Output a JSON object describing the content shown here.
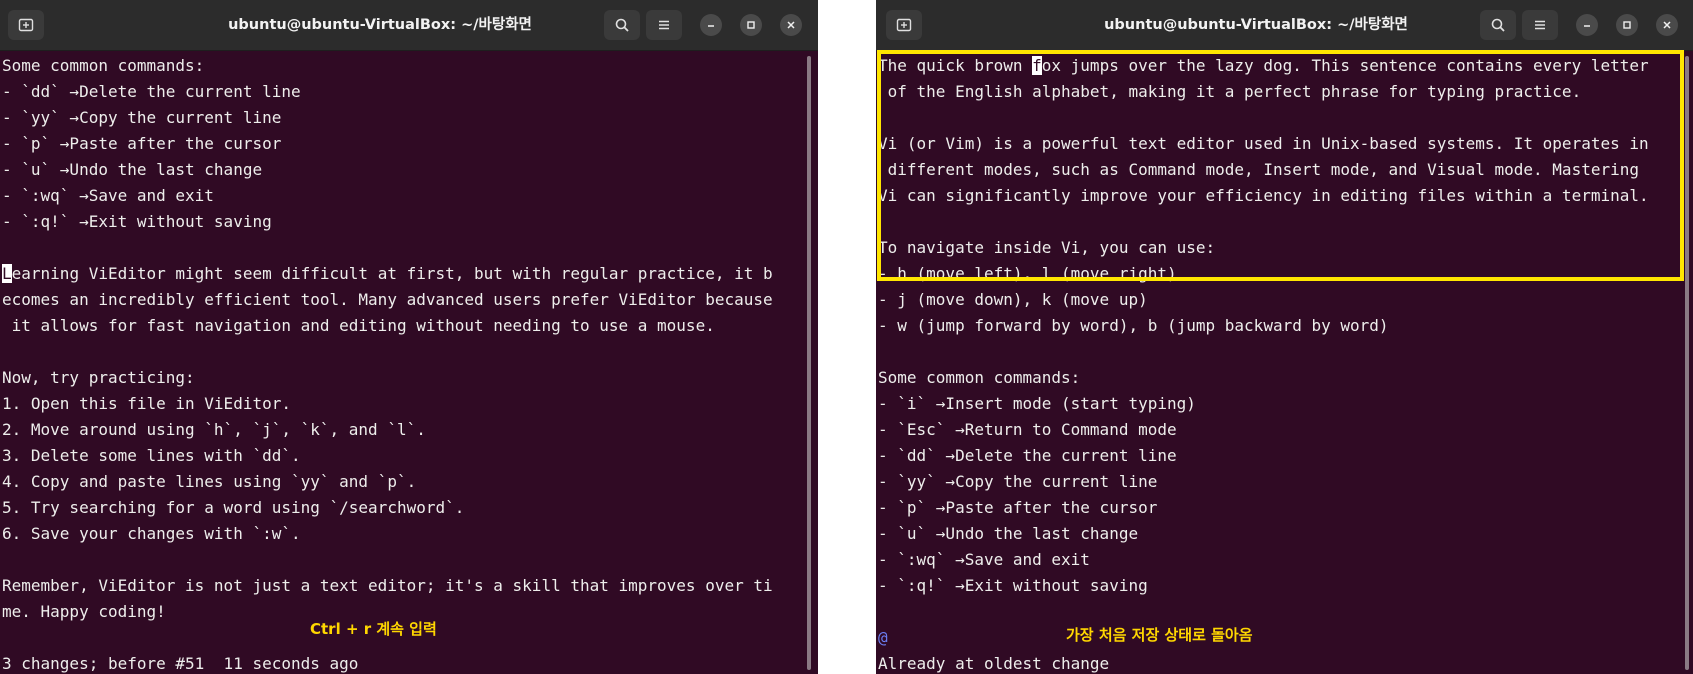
{
  "left_terminal": {
    "title": "ubuntu@ubuntu-VirtualBox: ~/바탕화면",
    "lines": [
      "Some common commands:",
      "- `dd` →Delete the current line",
      "- `yy` →Copy the current line",
      "- `p` →Paste after the cursor",
      "- `u` →Undo the last change",
      "- `:wq` →Save and exit",
      "- `:q!` →Exit without saving",
      "",
      "Learning ViEditor might seem difficult at first, but with regular practice, it b",
      "ecomes an incredibly efficient tool. Many advanced users prefer ViEditor because",
      " it allows for fast navigation and editing without needing to use a mouse.",
      "",
      "Now, try practicing:",
      "1. Open this file in ViEditor.",
      "2. Move around using `h`, `j`, `k`, and `l`.",
      "3. Delete some lines with `dd`.",
      "4. Copy and paste lines using `yy` and `p`.",
      "5. Try searching for a word using `/searchword`.",
      "6. Save your changes with `:w`.",
      "",
      "Remember, ViEditor is not just a text editor; it's a skill that improves over ti",
      "me. Happy coding!",
      ""
    ],
    "cursor_line": {
      "char": "L",
      "rest": "earning ViEditor might seem difficult at first, but with regular practice, it b"
    },
    "status_line": "3 changes; before #51  11 seconds ago",
    "annotation": "Ctrl + r 계속 입력"
  },
  "right_terminal": {
    "title": "ubuntu@ubuntu-VirtualBox: ~/바탕화면",
    "first_line": {
      "before": "The quick brown ",
      "cursor": "f",
      "after": "ox jumps over the lazy dog. This sentence contains every letter"
    },
    "lines": [
      " of the English alphabet, making it a perfect phrase for typing practice.",
      "",
      "Vi (or Vim) is a powerful text editor used in Unix-based systems. It operates in",
      " different modes, such as Command mode, Insert mode, and Visual mode. Mastering",
      "Vi can significantly improve your efficiency in editing files within a terminal.",
      "",
      "To navigate inside Vi, you can use:",
      "- h (move left), l (move right)",
      "- j (move down), k (move up)",
      "- w (jump forward by word), b (jump backward by word)",
      "",
      "Some common commands:",
      "- `i` →Insert mode (start typing)",
      "- `Esc` →Return to Command mode",
      "- `dd` →Delete the current line",
      "- `yy` →Copy the current line",
      "- `p` →Paste after the cursor",
      "- `u` →Undo the last change",
      "- `:wq` →Save and exit",
      "- `:q!` →Exit without saving",
      ""
    ],
    "at_marker": "@",
    "annotation": "가장 처음 저장 상태로 돌아옴",
    "status_line": "Already at oldest change"
  },
  "icons": {
    "new_tab": "new-tab-icon",
    "search": "search-icon",
    "menu": "hamburger-menu-icon",
    "minimize": "minimize-icon",
    "maximize": "maximize-icon",
    "close": "close-icon"
  },
  "colors": {
    "terminal_bg": "#300a24",
    "titlebar_bg": "#2c2c2c",
    "annotation": "#ffd700",
    "highlight_box": "#ffe600"
  }
}
